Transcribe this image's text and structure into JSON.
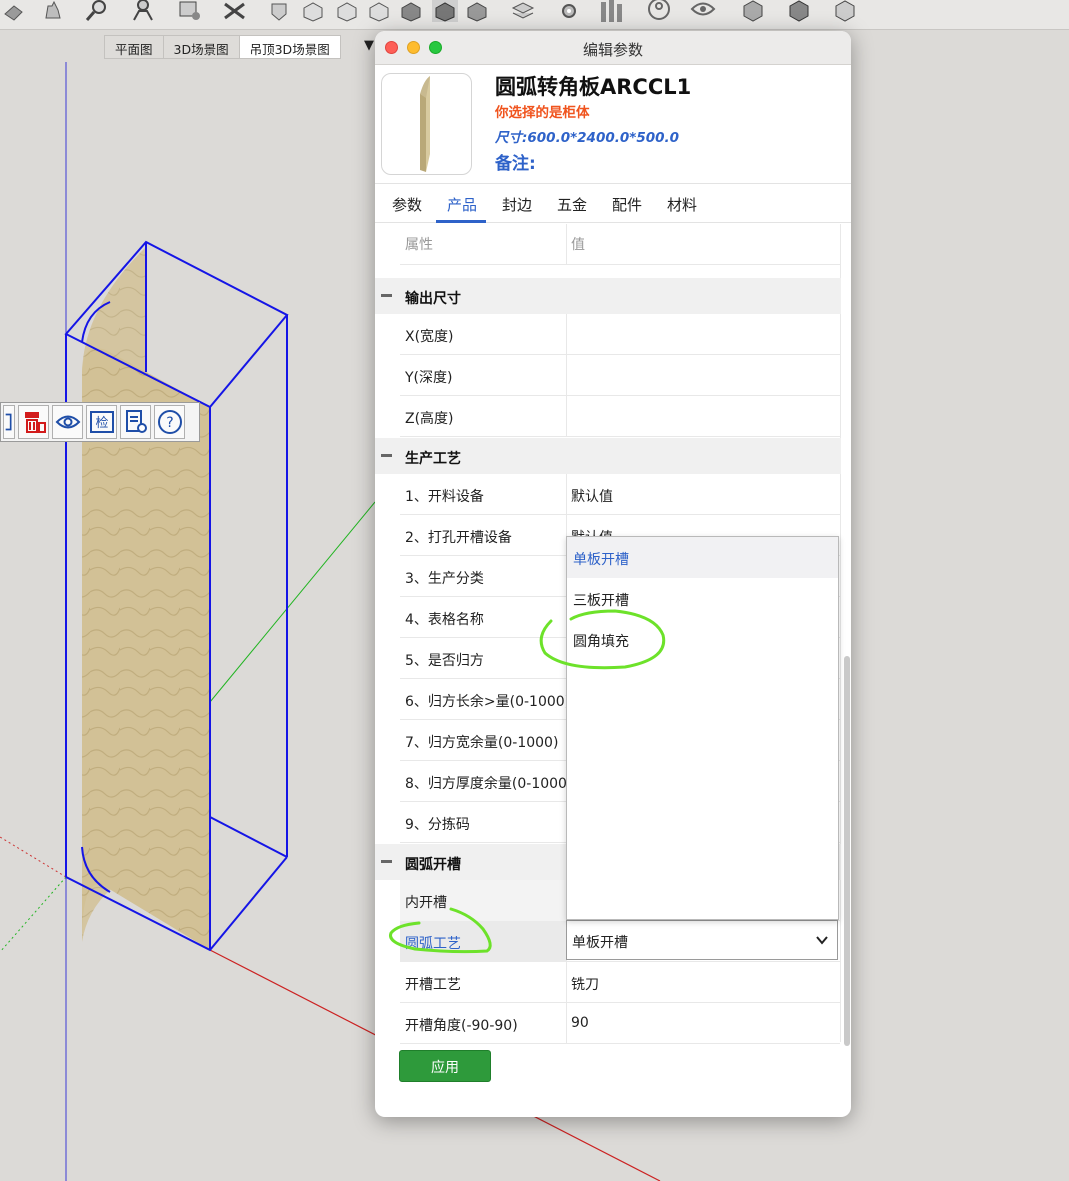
{
  "toolbar": {
    "icons": [
      "push-pull-icon",
      "hand-icon",
      "magnify-icon",
      "person-icon",
      "zoom-icon",
      "tools-icon",
      "arrow-down-icon",
      "box-icon",
      "box-icon",
      "box-icon",
      "box-icon",
      "box-icon",
      "box-icon",
      "layers-icon",
      "gear-icon",
      "bars-icon",
      "avatar-icon",
      "eye-icon",
      "cube-icon",
      "cube-icon",
      "cube-icon"
    ]
  },
  "scene_tabs": {
    "items": [
      "平面图",
      "3D场景图",
      "吊顶3D场景图"
    ],
    "active_index": 2,
    "more_arrow": "▼"
  },
  "mini_toolbar": {
    "buttons": [
      "select-corner-icon",
      "delete-red-icon",
      "eye-icon",
      "check-icon",
      "document-icon",
      "help-icon"
    ],
    "check_label": "检"
  },
  "dialog": {
    "title": "编辑参数",
    "product_name": "圆弧转角板ARCCL1",
    "selection_info": "你选择的是柜体",
    "size_info": "尺寸:600.0*2400.0*500.0",
    "note_label": "备注:",
    "tabs": [
      "参数",
      "产品",
      "封边",
      "五金",
      "配件",
      "材料"
    ],
    "active_tab": 1,
    "columns": {
      "property": "属性",
      "value": "值"
    },
    "sections": {
      "output_size": {
        "title": "输出尺寸",
        "rows": [
          {
            "name": "X(宽度)",
            "value": ""
          },
          {
            "name": "Y(深度)",
            "value": ""
          },
          {
            "name": "Z(高度)",
            "value": ""
          }
        ]
      },
      "production": {
        "title": "生产工艺",
        "rows": [
          {
            "name": "1、开料设备",
            "value": "默认值"
          },
          {
            "name": "2、打孔开槽设备",
            "value": "默认值"
          },
          {
            "name": "3、生产分类",
            "value": ""
          },
          {
            "name": "4、表格名称",
            "value": ""
          },
          {
            "name": "5、是否归方",
            "value": ""
          },
          {
            "name": "6、归方长余>量(0-1000)",
            "value": ""
          },
          {
            "name": "7、归方宽余量(0-1000)",
            "value": ""
          },
          {
            "name": "8、归方厚度余量(0-1000)",
            "value": ""
          },
          {
            "name": "9、分拣码",
            "value": ""
          }
        ]
      },
      "arc_groove": {
        "title": "圆弧开槽",
        "rows": [
          {
            "name": "内开槽",
            "value": ""
          },
          {
            "name": "圆弧工艺",
            "value": "单板开槽"
          },
          {
            "name": "开槽工艺",
            "value": "铣刀"
          },
          {
            "name": "开槽角度(-90-90)",
            "value": "90"
          }
        ]
      }
    },
    "dropdown_options": [
      "单板开槽",
      "三板开槽",
      "圆角填充"
    ],
    "dropdown_highlighted": 0,
    "apply_label": "应用"
  },
  "colors": {
    "accent_blue": "#2e62c9",
    "warning_orange": "#f0541e",
    "apply_green": "#2e9a3b",
    "annotation_green": "#6de22a",
    "model_edge_blue": "#1515e6"
  }
}
